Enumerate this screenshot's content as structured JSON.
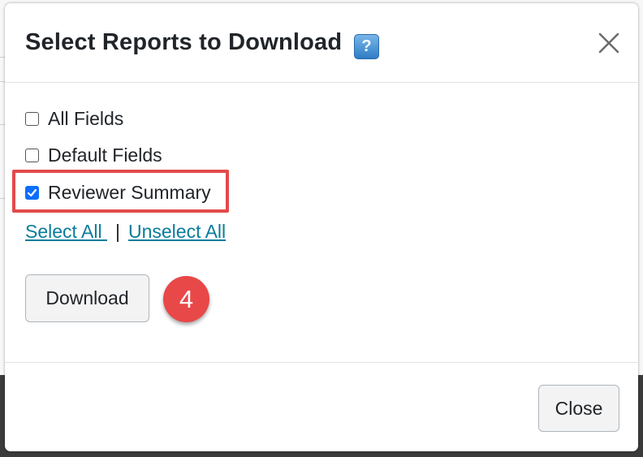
{
  "dialog": {
    "title": "Select Reports to Download",
    "help_icon_text": "?",
    "close_icon": "close-x-icon"
  },
  "options": [
    {
      "label": "All Fields",
      "checked": false
    },
    {
      "label": "Default Fields",
      "checked": false
    },
    {
      "label": "Reviewer Summary",
      "checked": true
    }
  ],
  "links": {
    "select_all": "Select All ",
    "separator": "|",
    "unselect_all": "Unselect All"
  },
  "download_label": "Download",
  "step_badge": "4",
  "footer": {
    "close_label": "Close"
  },
  "colors": {
    "highlight": "#e34a4a",
    "badge": "#e84848",
    "link": "#0a7c9c",
    "checkbox_checked": "#0d6efd"
  }
}
